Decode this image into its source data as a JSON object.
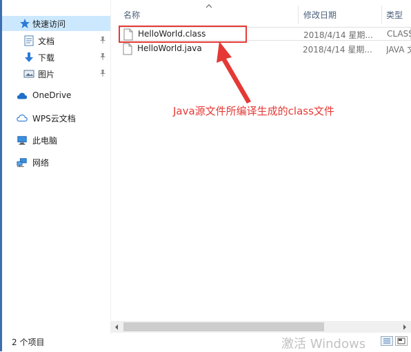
{
  "sidebar": {
    "quick_access": "快速访问",
    "items": [
      {
        "label": "文档",
        "icon": "document-icon",
        "pinned": true
      },
      {
        "label": "下载",
        "icon": "download-icon",
        "pinned": true
      },
      {
        "label": "图片",
        "icon": "picture-icon",
        "pinned": true
      }
    ],
    "onedrive": "OneDrive",
    "wps": "WPS云文档",
    "this_pc": "此电脑",
    "network": "网络"
  },
  "columns": {
    "name": "名称",
    "date": "修改日期",
    "type": "类型"
  },
  "files": [
    {
      "name": "HelloWorld.class",
      "date": "2018/4/14 星期...",
      "type": "CLASS"
    },
    {
      "name": "HelloWorld.java",
      "date": "2018/4/14 星期...",
      "type": "JAVA 文"
    }
  ],
  "annotation": "Java源文件所编译生成的class文件",
  "status": {
    "count": "2 个项目"
  },
  "watermark": "激活 Windows",
  "colors": {
    "selection": "#cce8ff",
    "annotation": "#e53935"
  }
}
